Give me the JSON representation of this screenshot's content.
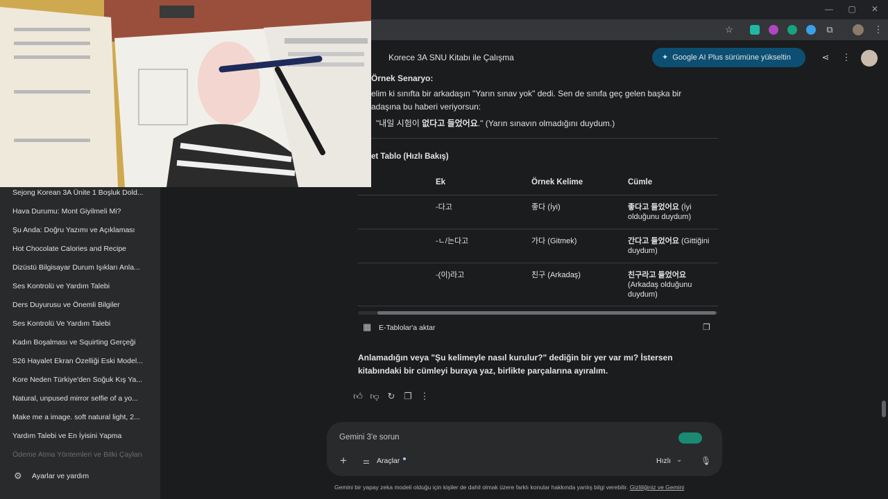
{
  "browser": {
    "window_controls": [
      "—",
      "▢",
      "✕"
    ]
  },
  "sidebar": {
    "items": [
      "Sejong Korean 3A Ünite 1 Boşluk Dold...",
      "Hava Durumu: Mont Giyilmeli Mi?",
      "Şu Anda: Doğru Yazımı ve Açıklaması",
      "Hot Chocolate Calories and Recipe",
      "Dizüstü Bilgisayar Durum Işıkları Anla...",
      "Ses Kontrolü ve Yardım Talebi",
      "Ders Duyurusu ve Önemli Bilgiler",
      "Ses Kontrolü Ve Yardım Talebi",
      "Kadın Boşalması ve Squirting Gerçeği",
      "S26 Hayalet Ekran Özelliği Eski Model...",
      "Kore Neden Türkiye'den Soğuk Kış Ya...",
      "Natural, unpused mirror selfie of a yo...",
      "Make me a image. soft natural light, 2...",
      "Yardım Talebi ve En İyisini Yapma",
      "Ödeme Atma Yöntemleri ve Bitki Çayları"
    ],
    "settings_label": "Ayarlar ve yardım"
  },
  "header": {
    "title": "Korece 3A SNU Kitabı ile Çalışma",
    "upgrade_label": "Google AI Plus sürümüne yükseltin"
  },
  "content": {
    "scenario_heading": "Örnek Senaryo:",
    "scenario_line1": "elim ki sınıfta bir arkadaşın \"Yarın sınav yok\" dedi. Sen de sınıfa geç gelen başka bir",
    "scenario_line2": "adaşına bu haberi veriyorsun:",
    "quote_pre": "\"내일 시험이 ",
    "quote_bold": "없다고 들었어요",
    "quote_post": ".\" (Yarın sınavın olmadığını duydum.)",
    "table_heading": "et Tablo (Hızlı Bakış)",
    "table": {
      "headers": [
        "Ek",
        "Örnek Kelime",
        "Cümle"
      ],
      "rows": [
        {
          "ek": "-다고",
          "kelime": "좋다 (İyi)",
          "cumle_bold": "좋다고 들었어요",
          "cumle_rest": " (İyi olduğunu duydum)"
        },
        {
          "ek": "-ㄴ/는다고",
          "kelime": "가다 (Gitmek)",
          "cumle_bold": "간다고 들었어요",
          "cumle_rest": " (Gittiğini duydum)"
        },
        {
          "ek": "-(이)라고",
          "kelime": "친구 (Arkadaş)",
          "cumle_bold": "친구라고 들었어요",
          "cumle_rest": " (Arkadaş olduğunu duydum)"
        }
      ]
    },
    "export_label": "E-Tablolar'a aktar",
    "closing_line1": "Anlamadığın veya \"Şu kelimeyle nasıl kurulur?\" dediğin bir yer var mı? İstersen",
    "closing_line2": "kitabındaki bir cümleyi buraya yaz, birlikte parçalarına ayıralım."
  },
  "composer": {
    "placeholder": "Gemini 3'e sorun",
    "tools_label": "Araçlar",
    "mode_label": "Hızlı"
  },
  "footer": {
    "disclaimer": "Gemini bir yapay zeka modeli olduğu için kişiler de dahil olmak üzere farklı konular hakkında yanlış bilgi verebilir. ",
    "privacy_link": "Gizliliğiniz ve Gemini"
  },
  "colors": {
    "background": "#1b1c1d",
    "sidebar": "#282a2c",
    "upgrade_button": "#0c4f72",
    "text": "#e3e3e3"
  }
}
